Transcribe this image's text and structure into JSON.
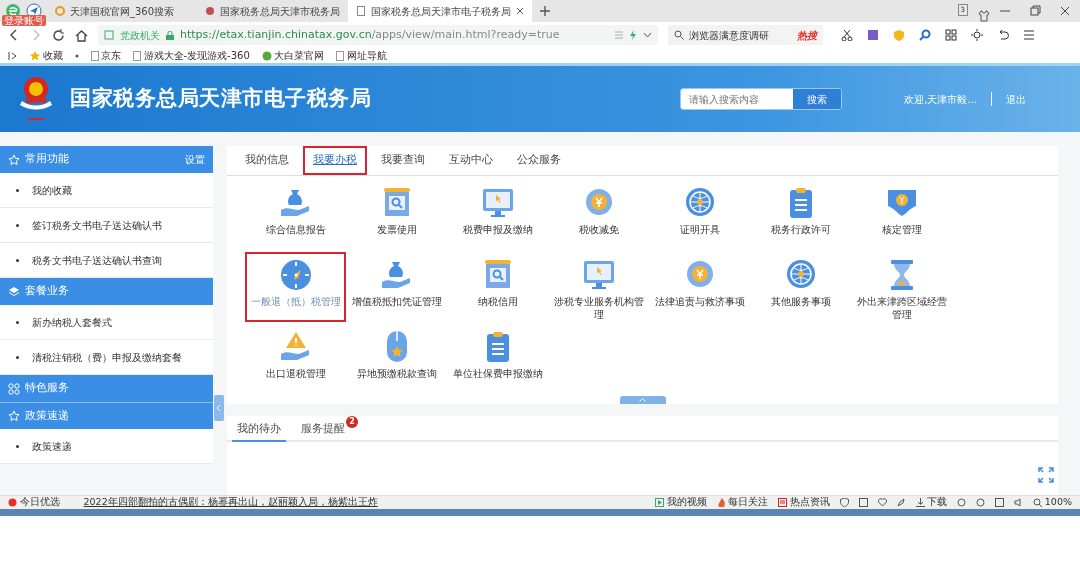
{
  "browser": {
    "badge": "登录账号",
    "tab_count": "3",
    "tabs": [
      {
        "title": "天津国税官网_360搜索",
        "selected": false
      },
      {
        "title": "国家税务总局天津市税务局",
        "selected": false
      },
      {
        "title": "国家税务总局天津市电子税务局",
        "selected": true
      }
    ],
    "site_label": "党政机关",
    "url_host": "https://etax.tianjin.chinatax.gov.cn",
    "url_path": "/apps/view/main.html?ready=true",
    "search_hint": "浏览器满意度调研",
    "hot": "热搜",
    "bookmarks": [
      "收藏",
      "京东",
      "游戏大全-发现游戏-360",
      "大白菜官网",
      "网址导航"
    ]
  },
  "header": {
    "title": "国家税务总局天津市电子税务局",
    "search_placeholder": "请输入搜索内容",
    "search_button": "搜索",
    "welcome": "欢迎,天津市毅...",
    "logout": "退出"
  },
  "sidebar": {
    "sections": [
      {
        "title": "常用功能",
        "action": "设置",
        "items": [
          "我的收藏",
          "签订税务文书电子送达确认书",
          "税务文书电子送达确认书查询"
        ]
      },
      {
        "title": "套餐业务",
        "items": [
          "新办纳税人套餐式",
          "清税注销税（费）申报及缴纳套餐"
        ]
      },
      {
        "title": "特色服务"
      },
      {
        "title": "政策速递",
        "items": [
          "政策速递"
        ]
      }
    ]
  },
  "main_tabs": [
    {
      "label": "我的信息",
      "selected": false,
      "highlighted": false
    },
    {
      "label": "我要办税",
      "selected": true,
      "highlighted": true
    },
    {
      "label": "我要查询",
      "selected": false,
      "highlighted": false
    },
    {
      "label": "互动中心",
      "selected": false,
      "highlighted": false
    },
    {
      "label": "公众服务",
      "selected": false,
      "highlighted": false
    }
  ],
  "services": [
    {
      "label": "综合信息报告",
      "highlighted": false
    },
    {
      "label": "发票使用",
      "highlighted": false
    },
    {
      "label": "税费申报及缴纳",
      "highlighted": false
    },
    {
      "label": "税收减免",
      "highlighted": false
    },
    {
      "label": "证明开具",
      "highlighted": false
    },
    {
      "label": "税务行政许可",
      "highlighted": false
    },
    {
      "label": "核定管理",
      "highlighted": false
    },
    {
      "label": "一般退（抵）税管理",
      "highlighted": true
    },
    {
      "label": "增值税抵扣凭证管理",
      "highlighted": false
    },
    {
      "label": "纳税信用",
      "highlighted": false
    },
    {
      "label": "涉税专业服务机构管理",
      "highlighted": false
    },
    {
      "label": "法律追责与救济事项",
      "highlighted": false
    },
    {
      "label": "其他服务事项",
      "highlighted": false
    },
    {
      "label": "外出来津跨区域经营管理",
      "highlighted": false
    },
    {
      "label": "出口退税管理",
      "highlighted": false
    },
    {
      "label": "异地预缴税款查询",
      "highlighted": false
    },
    {
      "label": "单位社保费申报缴纳",
      "highlighted": false
    }
  ],
  "bottom_tabs": [
    {
      "label": "我的待办",
      "selected": true
    },
    {
      "label": "服务提醒",
      "selected": false,
      "badge": "2"
    }
  ],
  "status_bar": {
    "left": "今日优选",
    "news": "2022年四部翻拍的古偶剧：杨幂再出山，赵丽颖入局，杨紫出王炸",
    "items": [
      "我的视频",
      "每日关注",
      "热点资讯"
    ],
    "download": "下载",
    "zoom": "100%"
  }
}
